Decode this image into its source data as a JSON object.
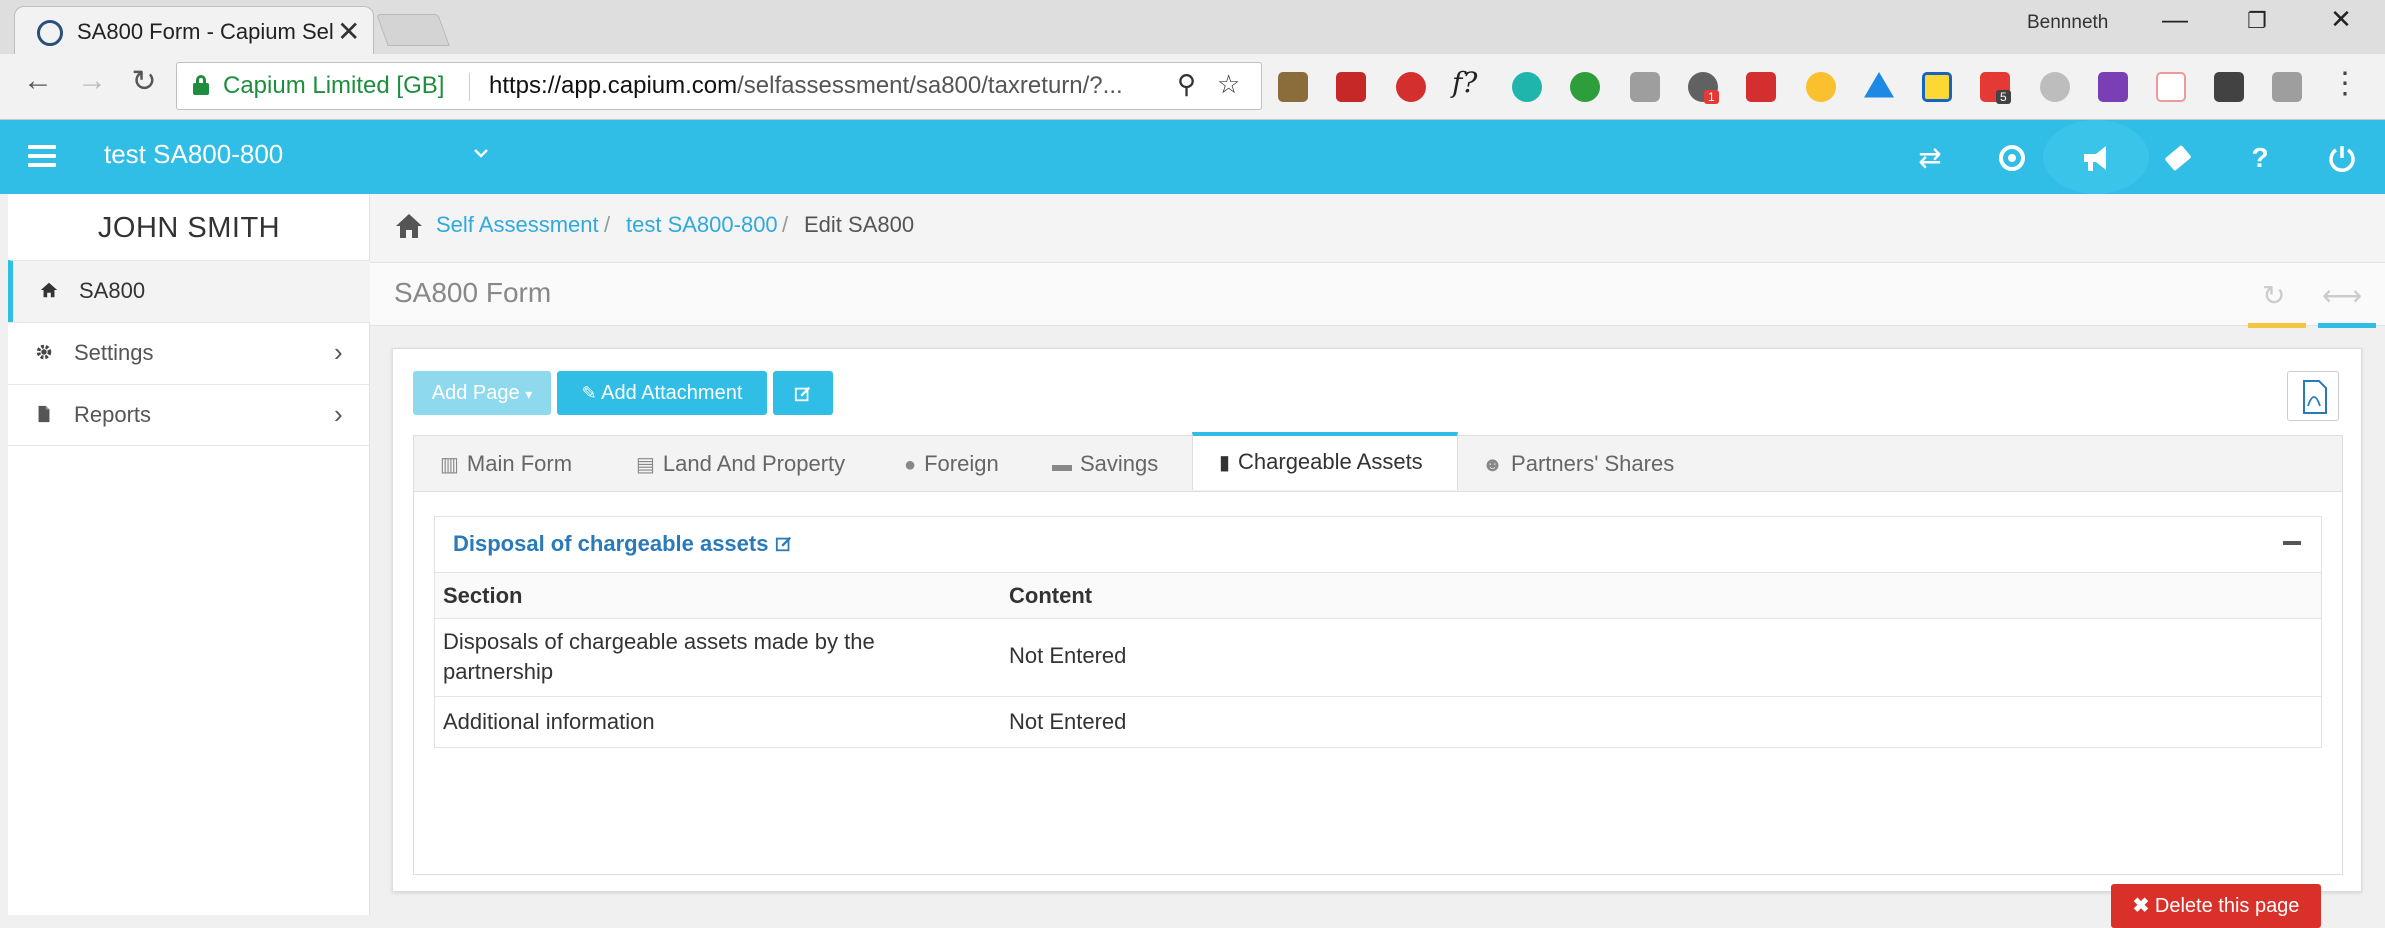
{
  "browser": {
    "tab_title": "SA800 Form - Capium Sel",
    "user_name": "Bennneth",
    "secure_label": "Capium Limited [GB]",
    "url_host": "https://app.capium.com",
    "url_path": "/selfassessment/sa800/taxreturn/?...",
    "ext_badge_1": "1",
    "ext_badge_5": "5"
  },
  "header": {
    "title": "test SA800-800"
  },
  "sidebar": {
    "user": "JOHN SMITH",
    "items": [
      {
        "label": "SA800"
      },
      {
        "label": "Settings"
      },
      {
        "label": "Reports"
      }
    ]
  },
  "breadcrumb": {
    "items": [
      "Self Assessment",
      "test SA800-800",
      "Edit SA800"
    ],
    "separator": "/"
  },
  "form": {
    "title": "SA800 Form",
    "add_page": "Add Page",
    "add_attachment": "Add Attachment",
    "tabs": [
      {
        "label": "Main Form"
      },
      {
        "label": "Land And Property"
      },
      {
        "label": "Foreign"
      },
      {
        "label": "Savings"
      },
      {
        "label": "Chargeable Assets"
      },
      {
        "label": "Partners' Shares"
      }
    ],
    "active_tab": "Chargeable Assets",
    "section_title": "Disposal of chargeable assets",
    "table": {
      "headers": [
        "Section",
        "Content"
      ],
      "rows": [
        {
          "section_line1": "Disposals of chargeable assets made by the",
          "section_line2": "partnership",
          "content": "Not Entered"
        },
        {
          "section": "Additional information",
          "content": "Not Entered"
        }
      ]
    },
    "delete_label": "Delete this page"
  },
  "colors": {
    "accent": "#30bde6",
    "link": "#2a7ab8",
    "danger": "#d9302a"
  }
}
